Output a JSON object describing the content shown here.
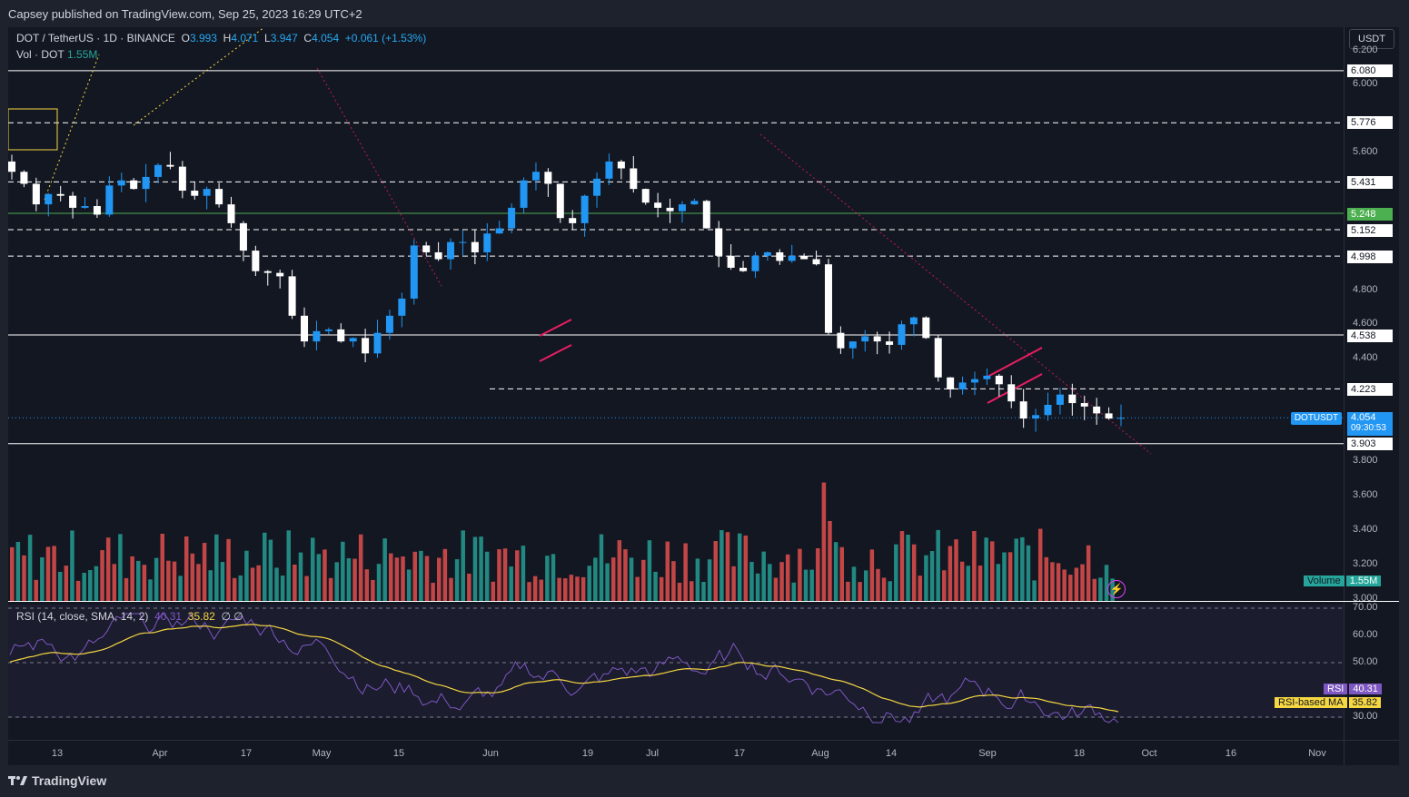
{
  "publisher": "Capsey published on TradingView.com, Sep 25, 2023 16:29 UTC+2",
  "legend": {
    "symbol": "DOT / TetherUS · 1D · BINANCE",
    "open_label": "O",
    "open": "3.993",
    "high_label": "H",
    "high": "4.071",
    "low_label": "L",
    "low": "3.947",
    "close_label": "C",
    "close": "4.054",
    "change": "+0.061 (+1.53%)",
    "volume_label": "Vol · DOT",
    "volume": "1.55M"
  },
  "currency_button": "USDT",
  "price_axis_ticks": [
    "6.200",
    "6.000",
    "5.600",
    "4.800",
    "4.600",
    "4.400",
    "3.800",
    "3.600",
    "3.400",
    "3.200",
    "3.000"
  ],
  "levels": {
    "l6080": "6.080",
    "l5776": "5.776",
    "l5431": "5.431",
    "l5248": "5.248",
    "l5152": "5.152",
    "l4998": "4.998",
    "l4538": "4.538",
    "l4223": "4.223",
    "l3903": "3.903"
  },
  "last_price": {
    "symbol": "DOTUSDT",
    "price": "4.054",
    "countdown": "09:30:53"
  },
  "volume_tag": {
    "label": "Volume",
    "value": "1.55M"
  },
  "rsi": {
    "title": "RSI (14, close, SMA, 14, 2)",
    "rsi_value": "40.31",
    "ma_value": "35.82",
    "extra1": "∅",
    "extra2": "∅",
    "ticks": [
      "70.00",
      "60.00",
      "50.00",
      "30.00"
    ],
    "rsi_tag": "RSI",
    "ma_tag": "RSI-based MA"
  },
  "date_ticks": [
    "13",
    "Apr",
    "17",
    "May",
    "15",
    "Jun",
    "19",
    "Jul",
    "17",
    "Aug",
    "14",
    "Sep",
    "18",
    "Oct",
    "16",
    "Nov"
  ],
  "footer": {
    "brand": "TradingView"
  },
  "colors": {
    "up": "#2196f3",
    "down": "#ffffff",
    "vol_up": "#26a69a",
    "vol_down": "#ef5350",
    "rsi_line": "#7e57c2",
    "rsi_ma": "#f5d742",
    "channel": "#e91e63"
  },
  "chart_data": {
    "type": "candlestick",
    "series": [
      {
        "name": "DOTUSDT",
        "values": [
          5.49,
          5.42,
          5.3,
          5.36,
          5.35,
          5.28,
          5.29,
          5.24,
          5.41,
          5.44,
          5.39,
          5.46,
          5.53,
          5.52,
          5.38,
          5.35,
          5.39,
          5.3,
          5.19,
          5.03,
          4.91,
          4.9,
          4.88,
          4.65,
          4.5,
          4.56,
          4.57,
          4.5,
          4.52,
          4.43,
          4.55,
          4.65,
          4.75,
          5.06,
          5.02,
          4.98,
          5.08,
          5.08,
          5.02,
          5.13,
          5.16,
          5.28,
          5.44,
          5.49,
          5.42,
          5.22,
          5.19,
          5.35,
          5.45,
          5.55,
          5.51,
          5.39,
          5.31,
          5.28,
          5.26,
          5.3,
          5.32,
          5.16,
          5.0,
          4.93,
          4.91,
          5.0,
          5.02,
          4.97,
          5.0,
          4.98,
          4.95,
          4.55,
          4.46,
          4.5,
          4.53,
          4.5,
          4.48,
          4.6,
          4.64,
          4.52,
          4.29,
          4.22,
          4.26,
          4.28,
          4.3,
          4.25,
          4.15,
          4.05,
          4.07,
          4.13,
          4.19,
          4.14,
          4.12,
          4.08,
          4.05,
          4.054
        ]
      },
      {
        "name": "Volume",
        "values": [
          1.55
        ]
      },
      {
        "name": "RSI",
        "values": [
          40.31
        ]
      },
      {
        "name": "RSI-based MA",
        "values": [
          35.82
        ]
      }
    ]
  }
}
